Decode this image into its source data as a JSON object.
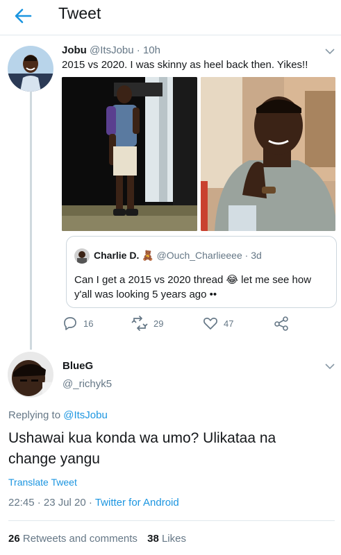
{
  "header": {
    "title": "Tweet"
  },
  "original_tweet": {
    "author_name": "Jobu",
    "author_handle": "@ItsJobu",
    "time": "· 10h",
    "text": "2015 vs 2020. I was skinny as heel back then. Yikes!!"
  },
  "quoted_tweet": {
    "author_name": "Charlie D.",
    "author_emoji": "🧸",
    "author_handle": "@Ouch_Charlieeee",
    "time": "· 3d",
    "text_line1": "Can I get a 2015 vs 2020 thread 😂 let me see how",
    "text_line2": "y'all was looking 5 years ago ••"
  },
  "actions": {
    "replies": "16",
    "retweets": "29",
    "likes": "47"
  },
  "reply": {
    "author_name": "BlueG",
    "author_handle": "@_richyk5",
    "replying_to_label": "Replying to",
    "replying_to_handle": "@ItsJobu",
    "text_line1": "Ushawai kua konda wa umo? Ulikataa na",
    "text_line2": "change yangu",
    "translate_label": "Translate Tweet",
    "timestamp": "22:45 · 23 Jul 20 ·",
    "source": "Twitter for Android"
  },
  "stats": {
    "retweets_count": "26",
    "retweets_label": "Retweets and comments",
    "likes_count": "38",
    "likes_label": "Likes"
  },
  "colors": {
    "accent": "#1b95e0",
    "muted": "#657786",
    "border": "#e1e8ed"
  }
}
